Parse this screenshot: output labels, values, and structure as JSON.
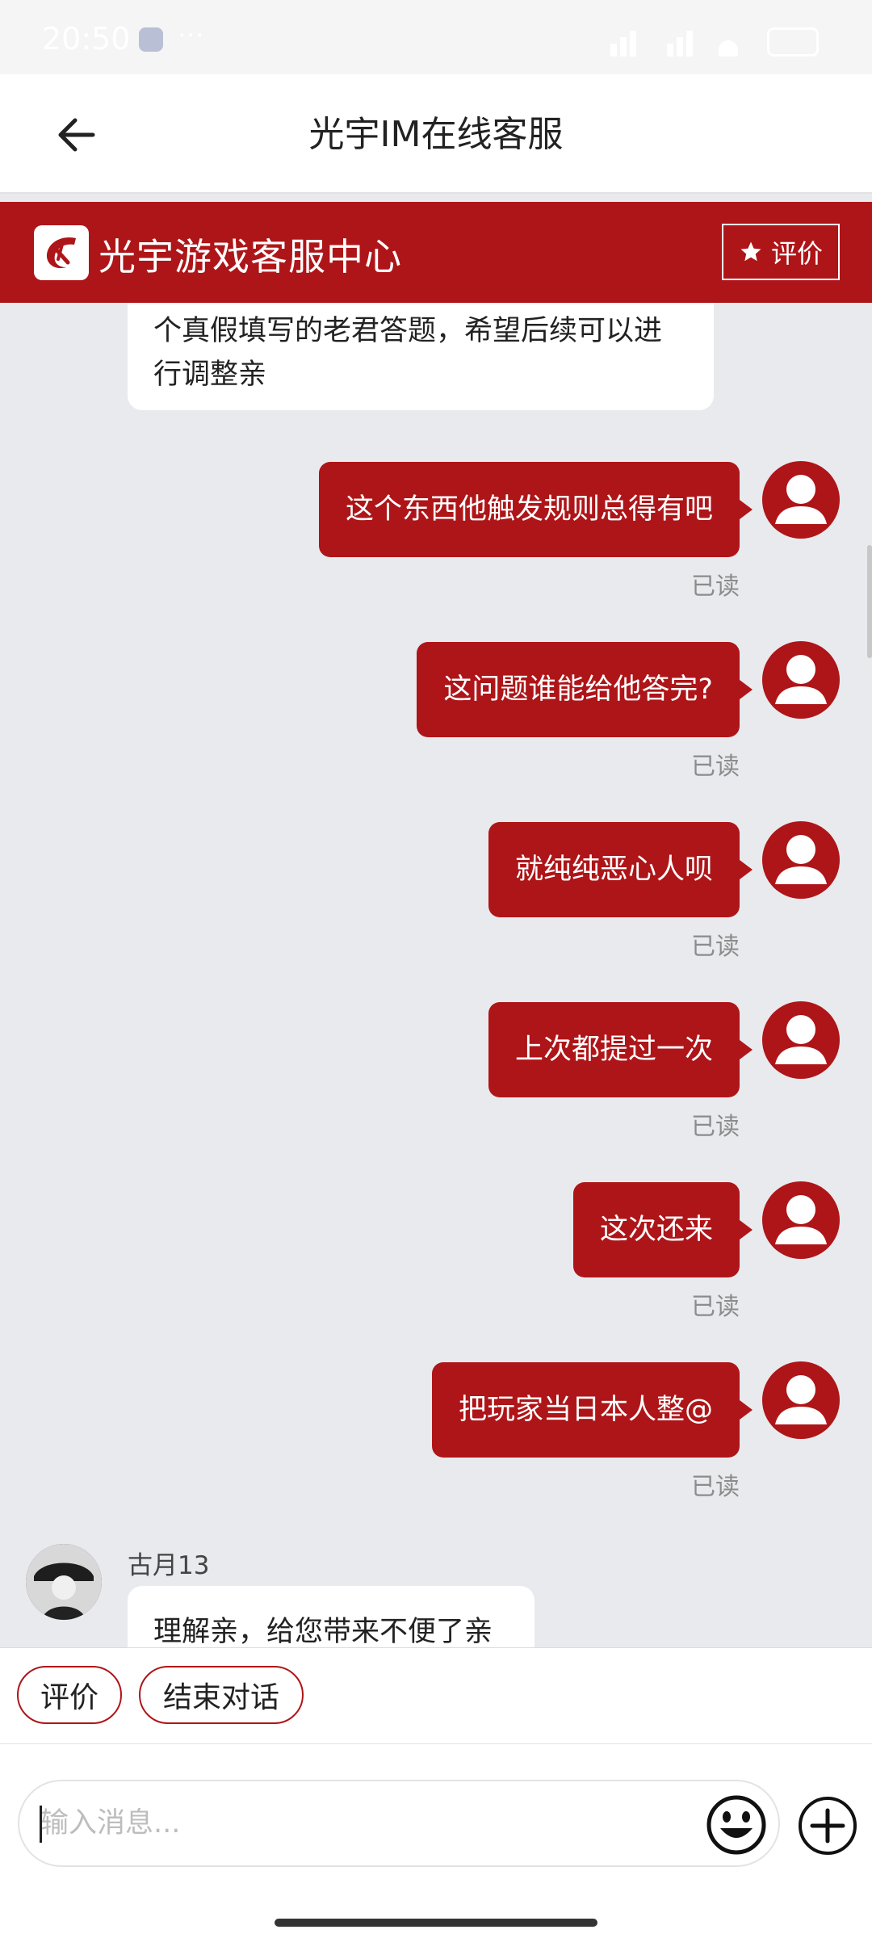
{
  "status_bar": {
    "time": "20:50",
    "overflow": "···"
  },
  "header": {
    "title": "光宇IM在线客服"
  },
  "banner": {
    "brand_name": "光宇游戏客服中心",
    "rate_label": "评价"
  },
  "chat": {
    "partial_agent_message": "个真假填写的老君答题，希望后续可以进行调整亲",
    "user_messages": [
      {
        "text": "这个东西他触发规则总得有吧",
        "status": "已读"
      },
      {
        "text": "这问题谁能给他答完?",
        "status": "已读"
      },
      {
        "text": "就纯纯恶心人呗",
        "status": "已读"
      },
      {
        "text": "上次都提过一次",
        "status": "已读"
      },
      {
        "text": "这次还来",
        "status": "已读"
      },
      {
        "text": "把玩家当日本人整@",
        "status": "已读"
      }
    ],
    "agent": {
      "name": "古月13",
      "message": "理解亲，给您带来不便了亲"
    }
  },
  "quick_actions": {
    "rate": "评价",
    "end": "结束对话"
  },
  "input": {
    "placeholder": "输入消息..."
  },
  "colors": {
    "brand": "#ae1518",
    "background": "#e9eaee"
  },
  "icons": [
    "back-arrow-icon",
    "star-icon",
    "user-avatar-icon",
    "emoji-icon",
    "plus-icon"
  ]
}
